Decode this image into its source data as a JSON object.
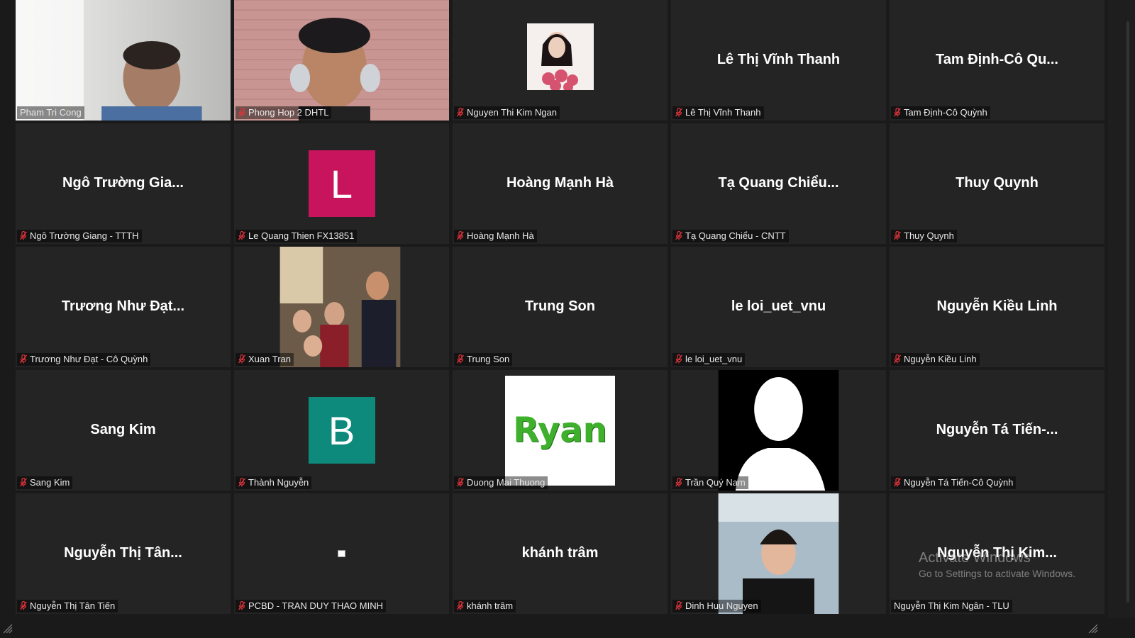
{
  "meeting": {
    "participants": [
      {
        "display": "",
        "label": "Pham Tri Cong",
        "muted": false,
        "kind": "video",
        "scene": "man-indoor",
        "active": true
      },
      {
        "display": "",
        "label": "Phong Hop 2 DHTL",
        "muted": true,
        "kind": "video",
        "scene": "man-headset"
      },
      {
        "display": "",
        "label": "Nguyen Thi Kim Ngan",
        "muted": true,
        "kind": "photo",
        "scene": "woman-flowers"
      },
      {
        "display": "Lê Thị Vĩnh Thanh",
        "label": "Lê Thị Vĩnh Thanh",
        "muted": true,
        "kind": "name"
      },
      {
        "display": "Tam Định-Cô Qu...",
        "label": "Tam Định-Cô Quỳnh",
        "muted": true,
        "kind": "name"
      },
      {
        "display": "Ngô Trường Gia...",
        "label": "Ngô Trường Giang - TTTH",
        "muted": true,
        "kind": "name"
      },
      {
        "display": "L",
        "label": "Le Quang Thien FX13851",
        "muted": true,
        "kind": "letter",
        "color": "#c8135d"
      },
      {
        "display": "Hoàng Mạnh Hà",
        "label": "Hoàng Mạnh Hà",
        "muted": true,
        "kind": "name"
      },
      {
        "display": "Tạ Quang Chiểu...",
        "label": "Tạ Quang Chiểu - CNTT",
        "muted": true,
        "kind": "name"
      },
      {
        "display": "Thuy Quynh",
        "label": "Thuy Quynh",
        "muted": true,
        "kind": "name"
      },
      {
        "display": "Trương Như Đạt...",
        "label": "Trương Như Đạt - Cô Quỳnh",
        "muted": true,
        "kind": "name"
      },
      {
        "display": "",
        "label": "Xuan Tran",
        "muted": true,
        "kind": "photo",
        "scene": "family"
      },
      {
        "display": "Trung Son",
        "label": "Trung Son",
        "muted": true,
        "kind": "name"
      },
      {
        "display": "le loi_uet_vnu",
        "label": "le loi_uet_vnu",
        "muted": true,
        "kind": "name"
      },
      {
        "display": "Nguyễn Kiều Linh",
        "label": "Nguyễn Kiều Linh",
        "muted": true,
        "kind": "name"
      },
      {
        "display": "Sang Kim",
        "label": "Sang Kim",
        "muted": true,
        "kind": "name"
      },
      {
        "display": "B",
        "label": "Thành Nguyễn",
        "muted": true,
        "kind": "letter",
        "color": "#0e8a7d"
      },
      {
        "display": "Ryan",
        "label": "Duong Mai Thuong",
        "muted": true,
        "kind": "ryan"
      },
      {
        "display": "",
        "label": "Trần Quý Nam",
        "muted": true,
        "kind": "silhouette"
      },
      {
        "display": "Nguyễn Tá Tiến-...",
        "label": "Nguyễn Tá Tiến-Cô Quỳnh",
        "muted": true,
        "kind": "name"
      },
      {
        "display": "Nguyễn Thị Tân...",
        "label": "Nguyễn Thị Tân Tiến",
        "muted": true,
        "kind": "name"
      },
      {
        "display": "",
        "label": "PCBD - TRAN DUY THAO MINH",
        "muted": true,
        "kind": "tiny-icon"
      },
      {
        "display": "khánh trâm",
        "label": "khánh trâm",
        "muted": true,
        "kind": "name"
      },
      {
        "display": "",
        "label": "Dinh Huu Nguyen",
        "muted": true,
        "kind": "photo",
        "scene": "young-man"
      },
      {
        "display": "Nguyễn Thị Kim...",
        "label": "Nguyễn Thị Kim Ngân - TLU",
        "muted": false,
        "kind": "name"
      }
    ]
  },
  "watermark": {
    "line1": "Activate Windows",
    "line2": "Go to Settings to activate Windows."
  },
  "colors": {
    "tile_bg": "#242424",
    "active_border": "#c9e26b",
    "mic_muted": "#e0343c"
  }
}
